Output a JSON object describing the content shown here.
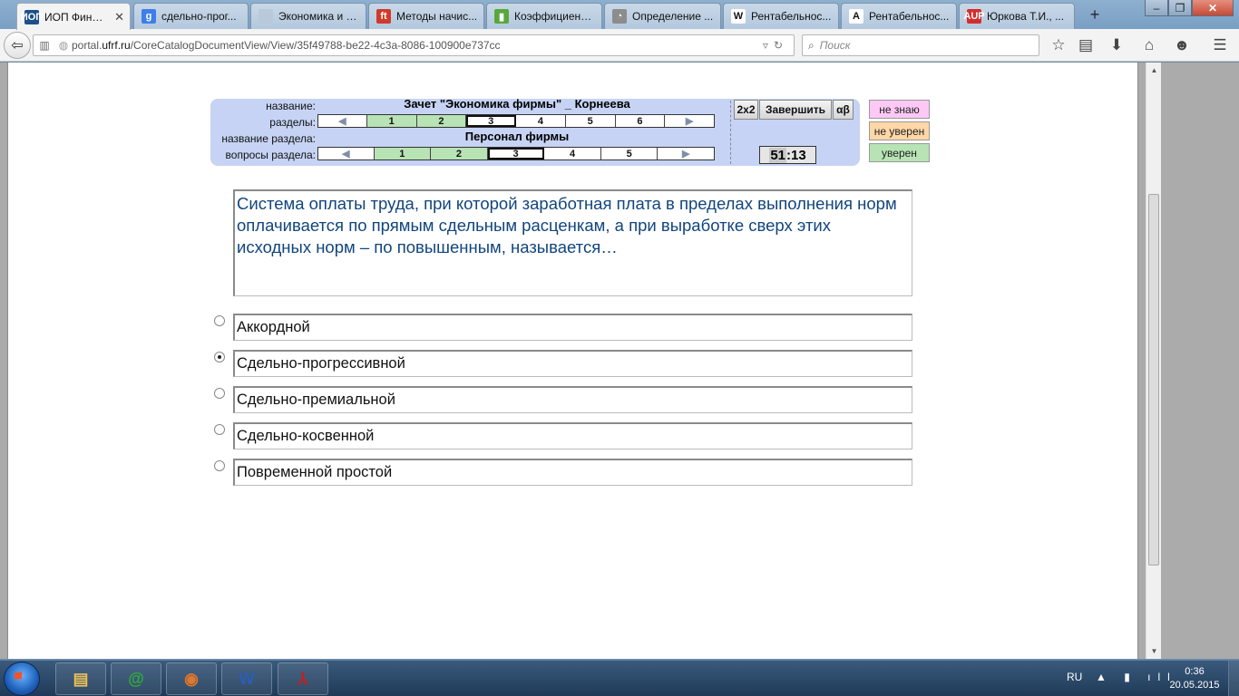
{
  "browser": {
    "tabs": [
      {
        "title": "ИОП Фину...",
        "fav": "ИОП",
        "color": "#1c4f8a",
        "active": true
      },
      {
        "title": "сдельно-прог...",
        "fav": "g",
        "color": "#3f7ee8",
        "active": false
      },
      {
        "title": "Экономика и соци...",
        "fav": "",
        "color": "#b9c9d9",
        "active": false
      },
      {
        "title": "Методы начис...",
        "fav": "ft",
        "color": "#d03a2a",
        "active": false
      },
      {
        "title": "Коэффициент ...",
        "fav": "▮",
        "color": "#58a83b",
        "active": false
      },
      {
        "title": "Определение ...",
        "fav": "◔",
        "color": "#8c8c8c",
        "active": false
      },
      {
        "title": "Рентабельнос...",
        "fav": "W",
        "color": "#ffffff",
        "active": false
      },
      {
        "title": "Рентабельнос...",
        "fav": "A",
        "color": "#ffffff",
        "active": false
      },
      {
        "title": "Юркова Т.И., ...",
        "fav": "AUP",
        "color": "#d42d2d",
        "active": false
      }
    ],
    "new_tab": "+",
    "url_prefix": "portal.",
    "url_host": "ufrf.ru",
    "url_path": "/CoreCatalogDocumentView/View/35f49788-be22-4c3a-8086-100900e737cc",
    "search_placeholder": "Поиск",
    "window_controls": {
      "minimize": "‒",
      "maximize": "❐",
      "close": "✕"
    }
  },
  "test": {
    "labels": {
      "name": "название:",
      "sections": "разделы:",
      "section_name": "название раздела:",
      "section_questions": "вопросы раздела:"
    },
    "title": "Зачет \"Экономика фирмы\" _ Корнеева",
    "section_title": "Персонал фирмы",
    "sections": [
      {
        "label": "1",
        "state": "done"
      },
      {
        "label": "2",
        "state": "done"
      },
      {
        "label": "3",
        "state": "current"
      },
      {
        "label": "4",
        "state": "todo"
      },
      {
        "label": "5",
        "state": "todo"
      },
      {
        "label": "6",
        "state": "todo"
      }
    ],
    "questions": [
      {
        "label": "1",
        "state": "done"
      },
      {
        "label": "2",
        "state": "done"
      },
      {
        "label": "3",
        "state": "current"
      },
      {
        "label": "4",
        "state": "todo"
      },
      {
        "label": "5",
        "state": "todo"
      }
    ],
    "arrow_prev": "◀",
    "arrow_next": "▶",
    "buttons": {
      "grid": "2x2",
      "finish": "Завершить",
      "alphabet": "αβ"
    },
    "timer_minutes": "51",
    "timer_seconds": ":13",
    "confidence": [
      {
        "label": "не знаю",
        "color": "#fdc8f5"
      },
      {
        "label": "не уверен",
        "color": "#fdd7a6"
      },
      {
        "label": "уверен",
        "color": "#b7e3b5"
      }
    ]
  },
  "question": {
    "text": "Система оплаты труда, при которой заработная плата  в пределах выполнения норм оплачивается по прямым сдельным расценкам, а при выработке сверх этих исходных норм – по повышенным, называется…",
    "answers": [
      {
        "text": "Аккордной",
        "selected": false
      },
      {
        "text": "Сдельно-прогрессивной",
        "selected": true
      },
      {
        "text": "Сдельно-премиальной",
        "selected": false
      },
      {
        "text": "Сдельно-косвенной",
        "selected": false
      },
      {
        "text": "Повременной простой",
        "selected": false
      }
    ]
  },
  "taskbar": {
    "apps": [
      {
        "name": "explorer",
        "glyph": "▤",
        "color": "#e8c15a"
      },
      {
        "name": "mail-agent",
        "glyph": "@",
        "color": "#2fae3a"
      },
      {
        "name": "firefox",
        "glyph": "◉",
        "color": "#e0772a"
      },
      {
        "name": "word",
        "glyph": "W",
        "color": "#2b5eb3"
      },
      {
        "name": "acrobat",
        "glyph": "⅄",
        "color": "#c41f1f"
      }
    ],
    "language": "RU",
    "tray_icons": "▲ ▮ ıll",
    "time": "0:36",
    "date": "20.05.2015"
  }
}
